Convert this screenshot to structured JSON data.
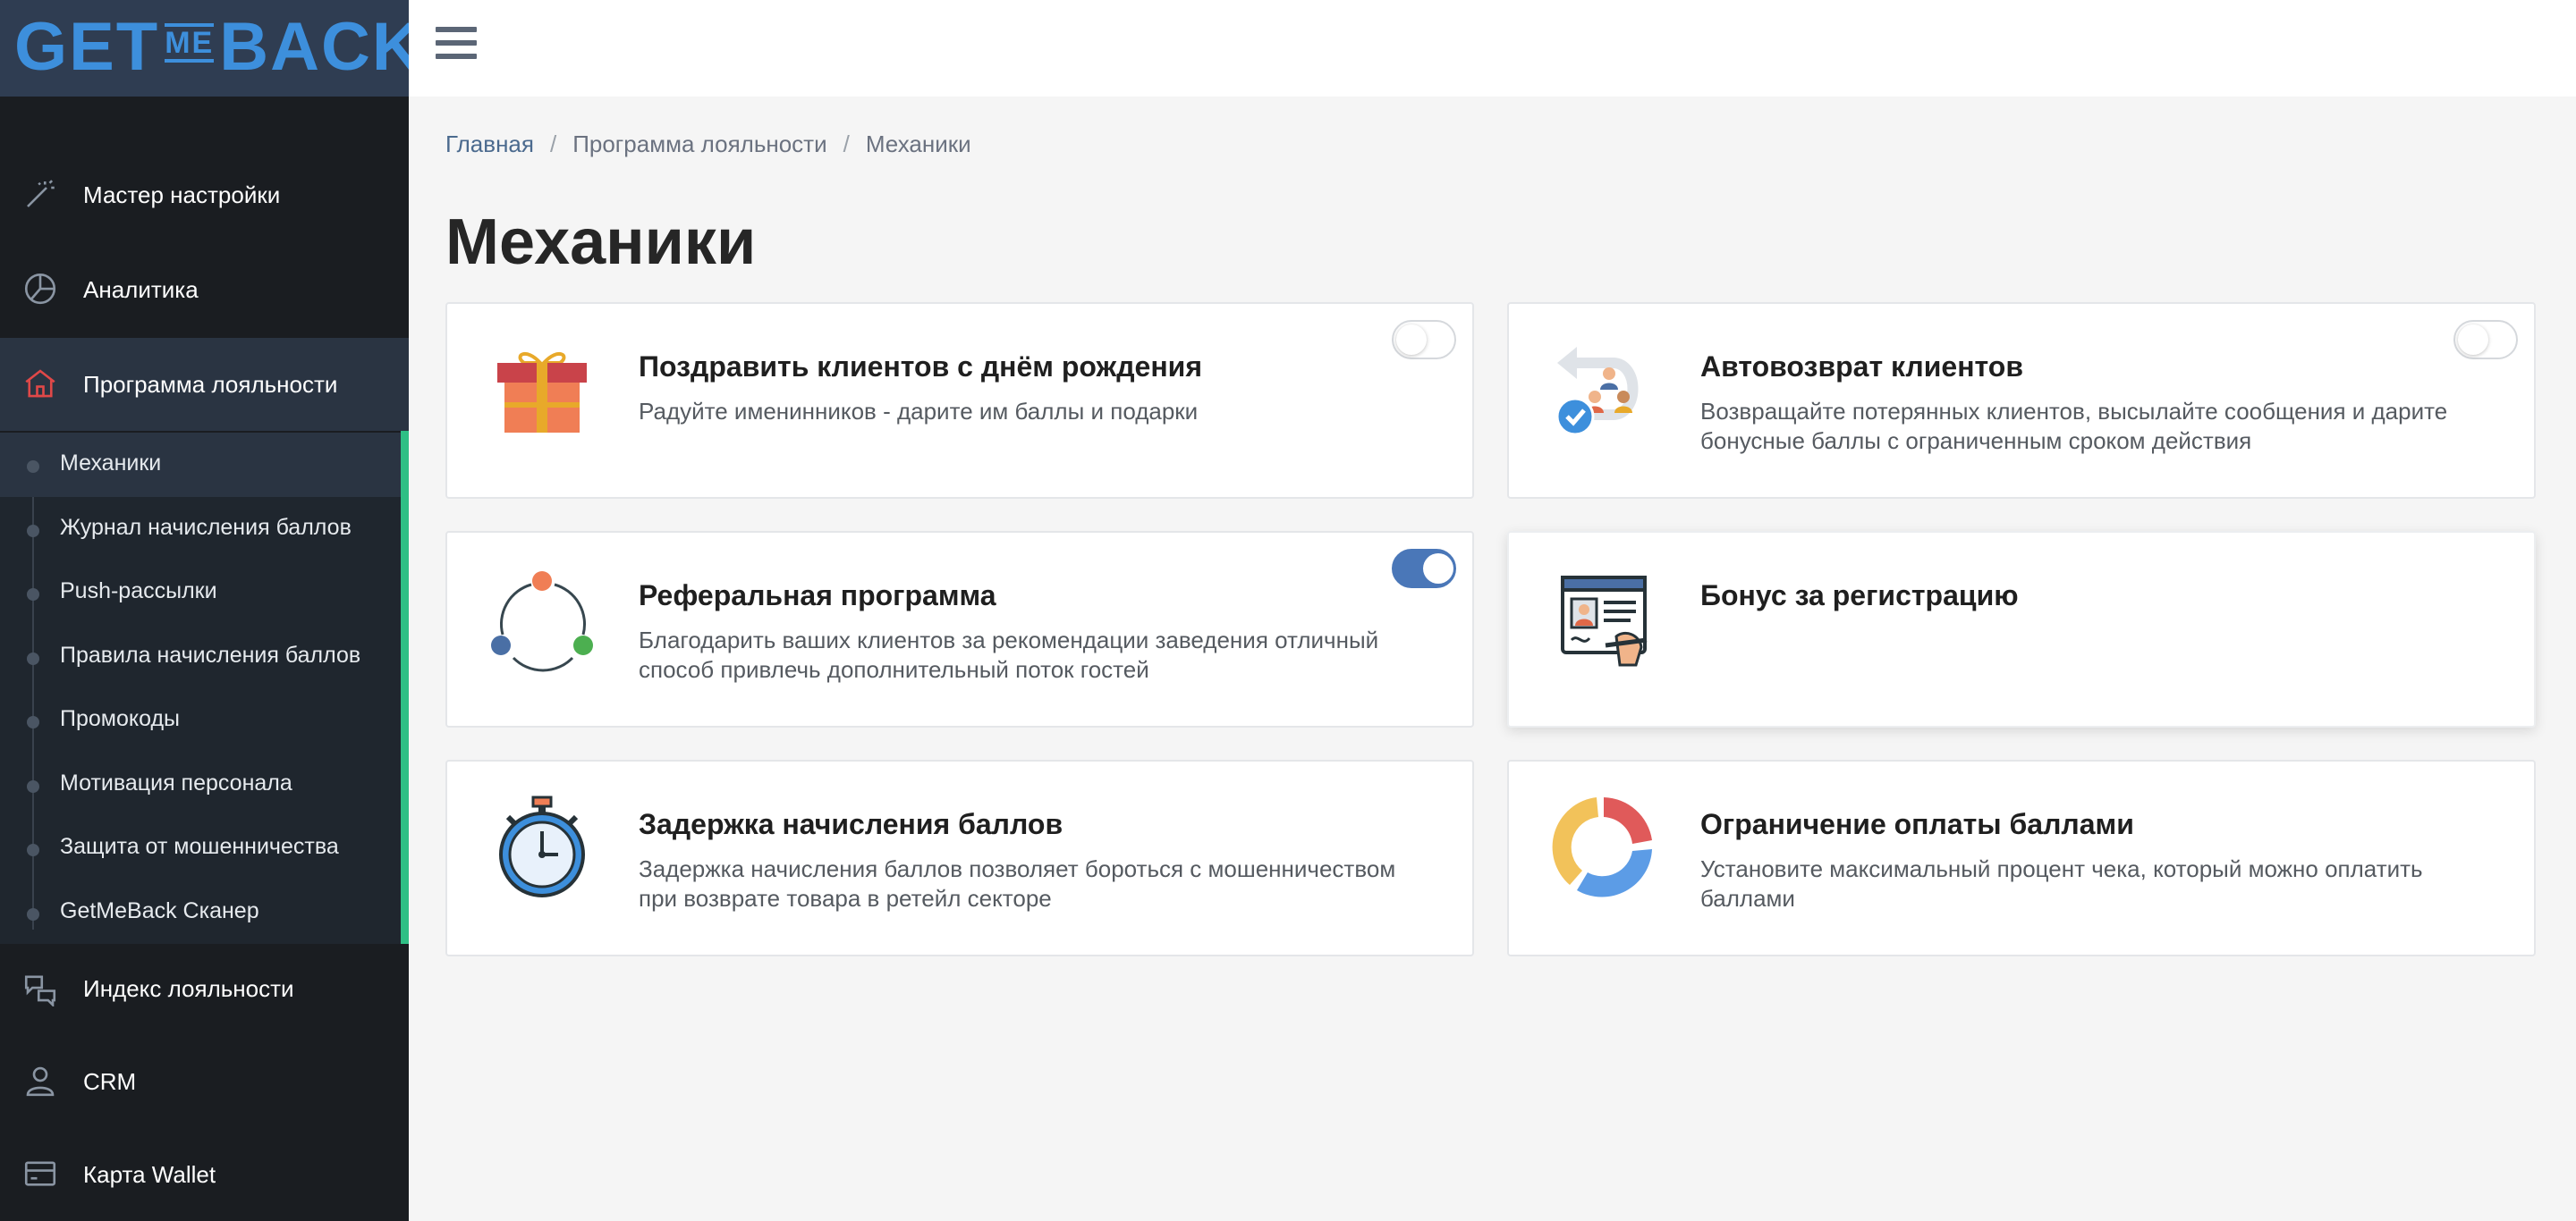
{
  "brand": {
    "logo_text_left": "GET",
    "logo_text_mid": "ME",
    "logo_text_right": "BACK"
  },
  "sidebar": {
    "items": [
      {
        "label": "Мастер настройки",
        "icon": "magic-wand-icon"
      },
      {
        "label": "Аналитика",
        "icon": "pie-chart-icon"
      },
      {
        "label": "Программа лояльности",
        "icon": "home-icon",
        "active": true
      },
      {
        "label": "Индекс лояльности",
        "icon": "chat-bubbles-icon"
      },
      {
        "label": "CRM",
        "icon": "user-icon"
      },
      {
        "label": "Карта Wallet",
        "icon": "wallet-card-icon"
      }
    ],
    "submenu": [
      {
        "label": "Механики",
        "active": true
      },
      {
        "label": "Журнал начисления баллов"
      },
      {
        "label": "Push-рассылки"
      },
      {
        "label": "Правила начисления баллов"
      },
      {
        "label": "Промокоды"
      },
      {
        "label": "Мотивация персонала"
      },
      {
        "label": "Защита от мошенничества"
      },
      {
        "label": "GetMeBack Сканер"
      }
    ]
  },
  "breadcrumb": {
    "home": "Главная",
    "section": "Программа лояльности",
    "current": "Механики",
    "separator": "/"
  },
  "page": {
    "title": "Механики"
  },
  "cards": [
    {
      "title": "Поздравить клиентов с днём рождения",
      "desc": "Радуйте именинников - дарите им баллы и подарки",
      "icon": "gift-icon",
      "toggle": false
    },
    {
      "title": "Автовозврат клиентов",
      "desc": "Возвращайте потерянных клиентов, высылайте сообщения и дарите бонусные баллы с ограниченным сроком действия",
      "icon": "return-clients-icon",
      "toggle": false
    },
    {
      "title": "Реферальная программа",
      "desc": "Благодарить ваших клиентов за рекомендации заведения отличный способ привлечь дополнительный поток гостей",
      "icon": "referral-cycle-icon",
      "toggle": true
    },
    {
      "title": "Бонус за регистрацию",
      "desc": "",
      "icon": "registration-form-icon"
    },
    {
      "title": "Задержка начисления баллов",
      "desc": "Задержка начисления баллов позволяет бороться с мошенничеством при возврате товара в ретейл секторе",
      "icon": "stopwatch-icon"
    },
    {
      "title": "Ограничение оплаты баллами",
      "desc": "Установите максимальный процент чека, который можно оплатить баллами",
      "icon": "donut-chart-icon"
    }
  ],
  "colors": {
    "sidebar_bg": "#1a1d21",
    "logo_bar_bg": "#2f3d52",
    "accent_green": "#2fbf85",
    "toggle_on": "#4a77b8",
    "brand_blue": "#3d8fdc"
  }
}
